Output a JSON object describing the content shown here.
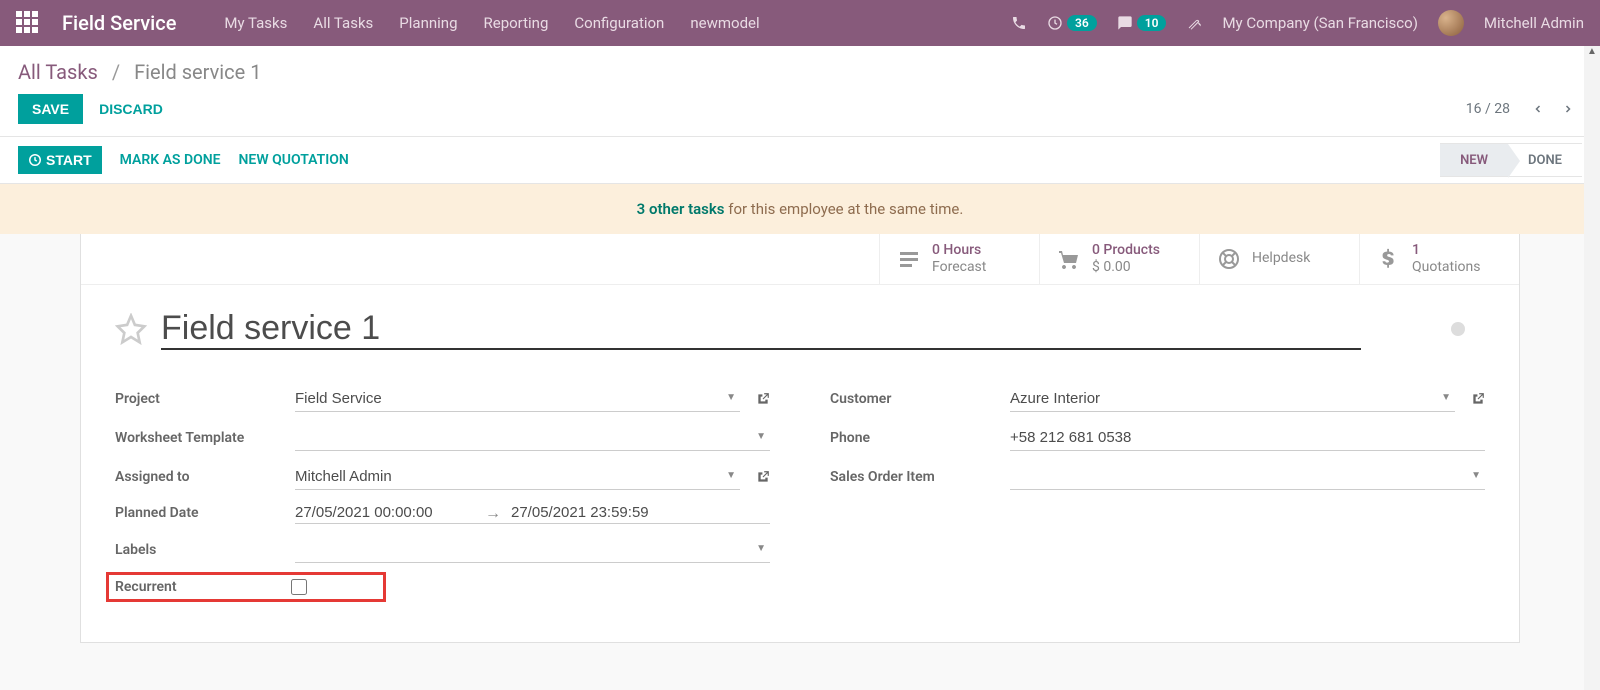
{
  "navbar": {
    "brand": "Field Service",
    "menu": [
      "My Tasks",
      "All Tasks",
      "Planning",
      "Reporting",
      "Configuration",
      "newmodel"
    ],
    "clock_badge": "36",
    "chat_badge": "10",
    "company": "My Company (San Francisco)",
    "user": "Mitchell Admin"
  },
  "breadcrumb": {
    "root": "All Tasks",
    "current": "Field service 1"
  },
  "controls": {
    "save": "SAVE",
    "discard": "DISCARD",
    "pager": "16 / 28"
  },
  "statusbar": {
    "start": "START",
    "mark_done": "MARK AS DONE",
    "new_quotation": "NEW QUOTATION",
    "tab_new": "NEW",
    "tab_done": "DONE"
  },
  "alert": {
    "link": "3 other tasks",
    "rest": " for this employee at the same time."
  },
  "stats": {
    "hours_top": "0  Hours",
    "hours_bottom": "Forecast",
    "products_top": "0 Products",
    "products_bottom": "$ 0.00",
    "helpdesk": "Helpdesk",
    "quotations_top": "1",
    "quotations_bottom": "Quotations"
  },
  "title": "Field service 1",
  "form": {
    "left": {
      "project_label": "Project",
      "project_value": "Field Service",
      "worksheet_label": "Worksheet Template",
      "worksheet_value": "",
      "assigned_label": "Assigned to",
      "assigned_value": "Mitchell Admin",
      "planned_label": "Planned Date",
      "planned_from": "27/05/2021 00:00:00",
      "planned_to": "27/05/2021 23:59:59",
      "labels_label": "Labels",
      "labels_value": "",
      "recurrent_label": "Recurrent"
    },
    "right": {
      "customer_label": "Customer",
      "customer_value": "Azure Interior",
      "phone_label": "Phone",
      "phone_value": "+58 212 681 0538",
      "sales_order_label": "Sales Order Item",
      "sales_order_value": ""
    }
  }
}
